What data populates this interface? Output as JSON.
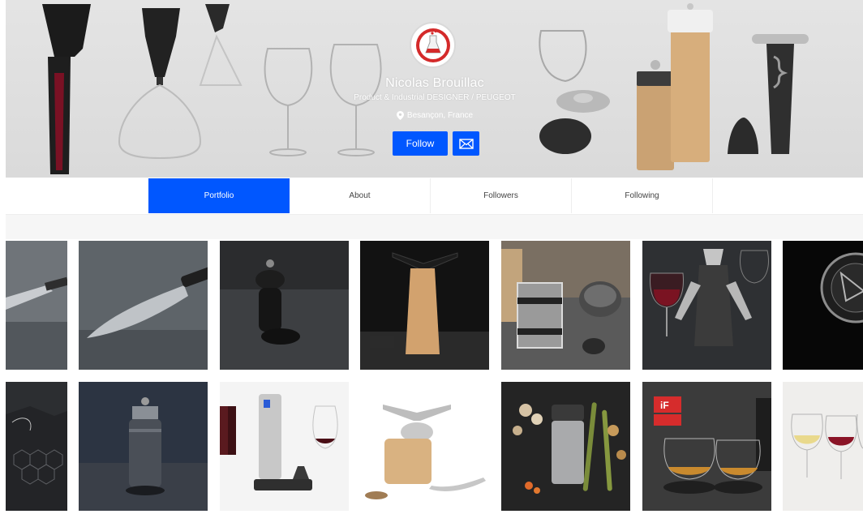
{
  "profile": {
    "name": "Nicolas Brouillac",
    "tagline": "Product & Industrial DESIGNER / PEUGEOT",
    "location": "Besançon, France",
    "avatar_icon": "lab-flask-icon"
  },
  "actions": {
    "follow_label": "Follow",
    "message_icon": "envelope-icon"
  },
  "tabs": [
    {
      "label": "Portfolio",
      "active": true
    },
    {
      "label": "About",
      "active": false
    },
    {
      "label": "Followers",
      "active": false
    },
    {
      "label": "Following",
      "active": false
    }
  ],
  "colors": {
    "accent": "#0057ff",
    "avatar_red": "#d42a2a"
  },
  "portfolio": {
    "row1": [
      {
        "subject": "knife"
      },
      {
        "subject": "santoku knife"
      },
      {
        "subject": "pepper mill"
      },
      {
        "subject": "wooden corkscrew"
      },
      {
        "subject": "french press"
      },
      {
        "subject": "wine corkscrew"
      },
      {
        "subject": "bottle cap"
      }
    ],
    "row2": [
      {
        "subject": "textured surface"
      },
      {
        "subject": "metal pepper mill"
      },
      {
        "subject": "electric corkscrew"
      },
      {
        "subject": "wooden grinder"
      },
      {
        "subject": "vegetable mill"
      },
      {
        "subject": "whisky glasses",
        "badge": "iF"
      },
      {
        "subject": "wine glasses"
      }
    ]
  }
}
